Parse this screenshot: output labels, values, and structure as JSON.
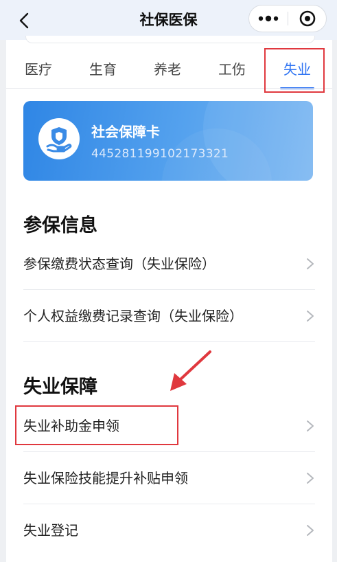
{
  "app": {
    "title": "社保医保"
  },
  "header": {
    "back_icon": "chevron-left-icon",
    "more_icon": "more-dots-icon",
    "close_icon": "target-circle-icon"
  },
  "tabs": [
    {
      "label": "医疗",
      "active": false
    },
    {
      "label": "生育",
      "active": false
    },
    {
      "label": "养老",
      "active": false
    },
    {
      "label": "工伤",
      "active": false
    },
    {
      "label": "失业",
      "active": true
    }
  ],
  "card": {
    "title": "社会保障卡",
    "number": "445281199102173321",
    "icon": "shield-hand-icon"
  },
  "sections": [
    {
      "title": "参保信息",
      "items": [
        {
          "label": "参保缴费状态查询（失业保险）"
        },
        {
          "label": "个人权益缴费记录查询（失业保险）"
        }
      ]
    },
    {
      "title": "失业保障",
      "items": [
        {
          "label": "失业补助金申领"
        },
        {
          "label": "失业保险技能提升补贴申领"
        },
        {
          "label": "失业登记"
        }
      ]
    }
  ],
  "colors": {
    "accent": "#2f74f3",
    "annotation": "#e0383e",
    "card_start": "#2f86e5",
    "card_end": "#7eb8f1"
  }
}
